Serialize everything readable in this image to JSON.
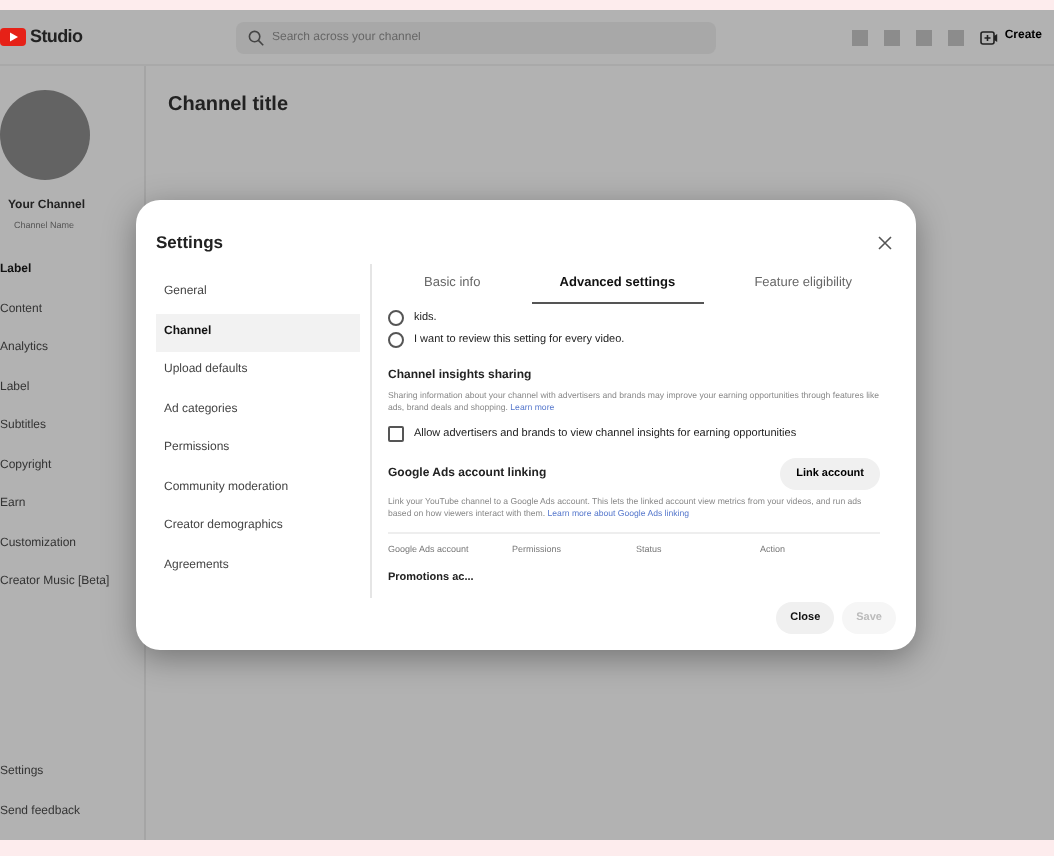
{
  "topbar": {
    "logo_text": "Studio",
    "search": {
      "placeholder": "Search across your channel"
    },
    "create": "Create"
  },
  "channel": {
    "title": "Channel title",
    "name": "Your Channel",
    "handle": "Channel Name"
  },
  "sidebar": {
    "items": [
      {
        "label": "Label",
        "selected": true
      },
      {
        "label": "Content",
        "selected": false
      },
      {
        "label": "Analytics",
        "selected": false
      },
      {
        "label": "Label",
        "selected": false
      },
      {
        "label": "Subtitles",
        "selected": false
      },
      {
        "label": "Copyright",
        "selected": false
      },
      {
        "label": "Earn",
        "selected": false
      },
      {
        "label": "Customization",
        "selected": false
      },
      {
        "label": "Creator Music [Beta]",
        "selected": false
      }
    ],
    "footer_items": [
      "Settings",
      "Send feedback"
    ]
  },
  "dialog": {
    "title": "Settings",
    "nav": [
      {
        "label": "General",
        "selected": false
      },
      {
        "label": "Channel",
        "selected": true
      },
      {
        "label": "Upload defaults",
        "selected": false
      },
      {
        "label": "Ad categories",
        "selected": false
      },
      {
        "label": "Permissions",
        "selected": false
      },
      {
        "label": "Community moderation",
        "selected": false
      },
      {
        "label": "Creator demographics",
        "selected": false
      },
      {
        "label": "Agreements",
        "selected": false
      }
    ],
    "tabs": [
      {
        "label": "Basic info",
        "selected": false
      },
      {
        "label": "Advanced settings",
        "selected": true
      },
      {
        "label": "Feature eligibility",
        "selected": false
      }
    ],
    "radio_options": [
      {
        "label": "kids.",
        "selected": false
      },
      {
        "label": "I want to review this setting for every video.",
        "selected": false
      }
    ],
    "insights": {
      "heading": "Channel insights sharing",
      "description": "Sharing information about your channel with advertisers and brands may improve your earning opportunities through features like ads, brand deals and shopping.",
      "link": "Learn more",
      "checkbox": {
        "label": "Allow advertisers and brands to view channel insights for earning opportunities",
        "checked": false
      }
    },
    "ads": {
      "heading": "Google Ads account linking",
      "button": "Link account",
      "description": "Link your YouTube channel to a Google Ads account. This lets the linked account view metrics from your videos, and run ads based on how viewers interact with them.",
      "link": "Learn more about Google Ads linking",
      "columns": [
        "Google Ads account",
        "Permissions",
        "Status",
        "Action"
      ],
      "rows": [
        [
          "Promotions ac..."
        ]
      ]
    },
    "buttons": [
      {
        "label": "Close",
        "disabled": false
      },
      {
        "label": "Save",
        "disabled": true
      }
    ]
  }
}
